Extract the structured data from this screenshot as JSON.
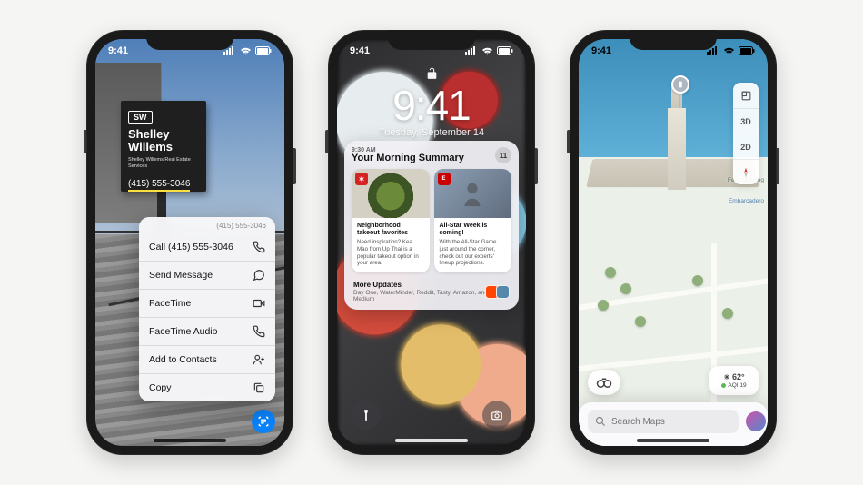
{
  "phone1": {
    "status_time": "9:41",
    "sign": {
      "badge": "SW",
      "name": "Shelley Willems",
      "sub": "Shelley Willems\nReal Estate Services",
      "phone": "(415) 555-3046"
    },
    "menu": {
      "header": "(415) 555-3046",
      "items": [
        {
          "label": "Call (415) 555-3046",
          "icon": "phone"
        },
        {
          "label": "Send Message",
          "icon": "message"
        },
        {
          "label": "FaceTime",
          "icon": "video"
        },
        {
          "label": "FaceTime Audio",
          "icon": "phone"
        },
        {
          "label": "Add to Contacts",
          "icon": "add-contact"
        },
        {
          "label": "Copy",
          "icon": "copy"
        }
      ]
    }
  },
  "phone2": {
    "status_time": "9:41",
    "time": "9:41",
    "date": "Tuesday, September 14",
    "summary": {
      "time": "9:30 AM",
      "title": "Your Morning Summary",
      "count": "11",
      "cards": [
        {
          "chip": "yelp",
          "title": "Neighborhood takeout favorites",
          "text": "Need inspiration? Kea Mao from Up Thai is a popular takeout option in your area."
        },
        {
          "chip": "espn",
          "chip_text": "E",
          "title": "All-Star Week is coming!",
          "text": "With the All-Star Game just around the corner, check out our experts' lineup projections."
        }
      ],
      "more_title": "More Updates",
      "more_text": "Day One, WaterMinder, Reddit, Tasty, Amazon, and Medium"
    }
  },
  "phone3": {
    "status_time": "9:41",
    "controls": {
      "threeD": "3D",
      "twoD": "2D"
    },
    "landmark": "Ferry Building",
    "labels": {
      "ferry": "Ferry Building",
      "embarcadero": "Embarcadero"
    },
    "weather": {
      "temp": "62°",
      "aqi": "AQI 19"
    },
    "search_placeholder": "Search Maps"
  }
}
